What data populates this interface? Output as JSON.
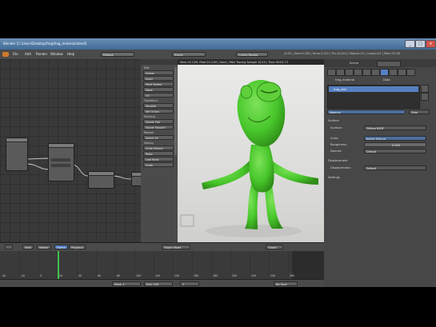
{
  "window": {
    "title": "Blender [C:\\Users\\Desktop\\frog\\frog_material.blend]",
    "controls": [
      "_",
      "□",
      "×"
    ]
  },
  "menubar": {
    "items": [
      "File",
      "Add",
      "Render",
      "Window",
      "Help"
    ],
    "layout_selector": "Default",
    "scene_selector": "Scene",
    "engine_selector": "Cycles Render",
    "info_text": "v2.61 | Verts:5,394 | Faces:5,312 | Tris:10,624 | Objects:1/3 | Lamps:0/1 | Mem:25.1M"
  },
  "tool_panel": {
    "labels": [
      "Edit",
      "Transform",
      "Shading",
      "Repeat",
      "History"
    ],
    "buttons": [
      "Image",
      "Input",
      "Paint Vertex",
      "Mask",
      "UV",
      "Smooth",
      "Set Origin",
      "Shade Flat",
      "Shade Smooth",
      "Select All",
      "Undo History",
      "Redo",
      "Last Redo",
      "Undo"
    ]
  },
  "viewport": {
    "header_text": "Mem:24.12M, Peak:24.12M | Done | Path Tracing Sample 10/10 | Time 00:03.73"
  },
  "properties": {
    "scene_label": "Scene",
    "material_label": "frog_material",
    "slot_label": "Material",
    "data_label": "Data",
    "surface_section": "Surface",
    "surface_label": "Surface:",
    "surface_value": "Diffuse BSDF",
    "color_label": "Color:",
    "color_value": "Image Texture",
    "roughness_label": "Roughness:",
    "roughness_value": "0.000",
    "normal_label": "Normal:",
    "normal_value": "Default",
    "displacement_section": "Displacement",
    "displacement_label": "Displacement:",
    "displacement_value": "Default",
    "settings_section": "Settings",
    "slot_list_item": "frog_skin"
  },
  "timeline": {
    "header": {
      "view_label": "View",
      "marker_label": "Marker",
      "frame_label": "Frame",
      "playback_label": "Playback",
      "editor_mode": "Object Mode",
      "global_label": "Global"
    },
    "frame_numbers": [
      "-40",
      "-20",
      "0",
      "20",
      "40",
      "60",
      "80",
      "100",
      "120",
      "140",
      "160",
      "180",
      "200",
      "220",
      "240",
      "260"
    ],
    "footer": {
      "start_label": "Start: 1",
      "end_label": "End: 250",
      "current_label": "1",
      "sync_label": "No Sync"
    }
  },
  "colors": {
    "accent_blue": "#5680c2",
    "frog_green": "#48c72b",
    "frog_dark": "#2f8d18",
    "playhead": "#3cc44a",
    "timeline_keyed": "#2c2c2c"
  }
}
